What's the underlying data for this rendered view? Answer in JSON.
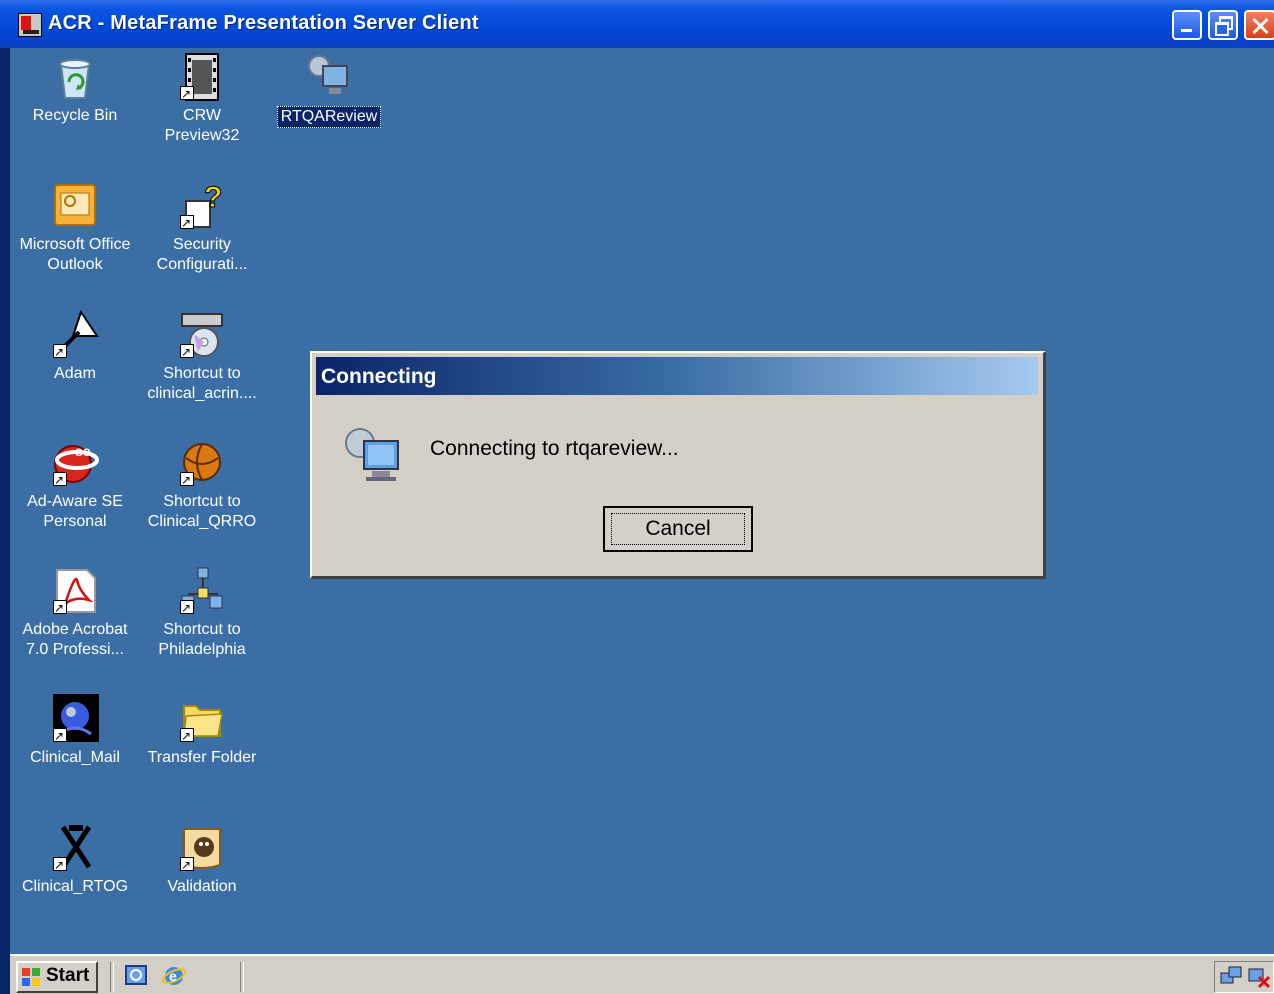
{
  "window": {
    "title": "ACR - MetaFrame Presentation Server Client",
    "buttons": [
      "minimize",
      "restore",
      "close"
    ]
  },
  "desktop": {
    "icons": [
      {
        "name": "recycle-bin-icon",
        "line1": "Recycle Bin",
        "line2": ""
      },
      {
        "name": "crw-preview-icon",
        "line1": "CRW",
        "line2": "Preview32"
      },
      {
        "name": "rtqareview-icon",
        "line1": "RTQAReview",
        "line2": "",
        "selected": true
      },
      {
        "name": "outlook-icon",
        "line1": "Microsoft Office",
        "line2": "Outlook"
      },
      {
        "name": "security-config-icon",
        "line1": "Security",
        "line2": "Configurati..."
      },
      {
        "name": "adam-icon",
        "line1": "Adam",
        "line2": ""
      },
      {
        "name": "clinical-acrin-icon",
        "line1": "Shortcut to",
        "line2": "clinical_acrin...."
      },
      {
        "name": "ad-aware-icon",
        "line1": "Ad-Aware SE",
        "line2": "Personal"
      },
      {
        "name": "clinical-qrro-icon",
        "line1": "Shortcut to",
        "line2": "Clinical_QRRO"
      },
      {
        "name": "adobe-acrobat-icon",
        "line1": "Adobe Acrobat",
        "line2": "7.0 Professi..."
      },
      {
        "name": "philadelphia-icon",
        "line1": "Shortcut to",
        "line2": "Philadelphia"
      },
      {
        "name": "clinical-mail-icon",
        "line1": "Clinical_Mail",
        "line2": ""
      },
      {
        "name": "transfer-folder-icon",
        "line1": "Transfer Folder",
        "line2": ""
      },
      {
        "name": "clinical-rtog-icon",
        "line1": "Clinical_RTOG",
        "line2": ""
      },
      {
        "name": "validation-icon",
        "line1": "Validation",
        "line2": ""
      }
    ]
  },
  "dialog": {
    "title": "Connecting",
    "message": "Connecting to rtqareview...",
    "cancel_label": "Cancel",
    "icon": "network-computer-icon"
  },
  "taskbar": {
    "start_label": "Start",
    "quick_launch": [
      "show-desktop-icon",
      "internet-explorer-icon"
    ],
    "tray": [
      "network-icon",
      "volume-icon"
    ]
  },
  "colors": {
    "desktop": "#3a6ea5",
    "titlebar": "#0a55e0",
    "dialog_bg": "#d4d0c8",
    "dialog_title": "#0a246a"
  }
}
